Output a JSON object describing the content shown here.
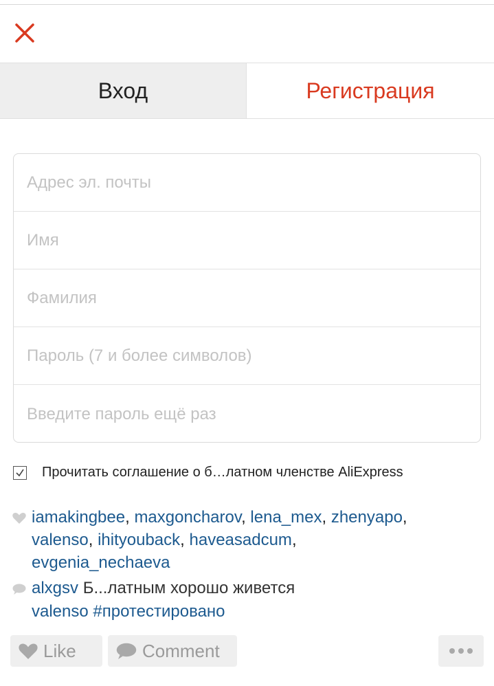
{
  "header": {
    "close_icon": "close-icon",
    "accent_color": "#d93a20"
  },
  "tabs": [
    {
      "label": "Вход",
      "active": false
    },
    {
      "label": "Регистрация",
      "active": true
    }
  ],
  "form": {
    "email": {
      "placeholder": "Адрес эл. почты",
      "value": ""
    },
    "first_name": {
      "placeholder": "Имя",
      "value": ""
    },
    "last_name": {
      "placeholder": "Фамилия",
      "value": ""
    },
    "password": {
      "placeholder": "Пароль (7 и более символов)",
      "value": ""
    },
    "password_confirm": {
      "placeholder": "Введите пароль ещё раз",
      "value": ""
    }
  },
  "agreement": {
    "checked": true,
    "text": "Прочитать соглашение о б…латном членстве AliExpress"
  },
  "likes": {
    "icon": "heart-icon",
    "users": [
      "iamakingbee",
      "maxgoncharov",
      "lena_mex",
      "zhenyapo",
      "valenso",
      "ihityouback",
      "haveasadcum",
      "evgenia_nechaeva"
    ]
  },
  "comments": [
    {
      "icon": "comment-bubble-icon",
      "user": "alxgsv",
      "text": "Б...латным хорошо живется"
    },
    {
      "user": "valenso",
      "text": "#протестировано"
    }
  ],
  "actions": {
    "like_label": "Like",
    "comment_label": "Comment",
    "more_icon": "more-dots-icon"
  },
  "link_color": "#1d5a8f"
}
